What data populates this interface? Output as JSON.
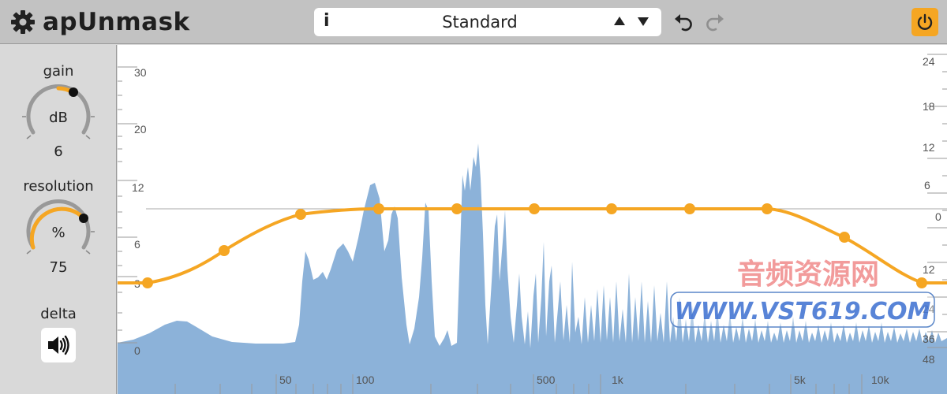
{
  "app": {
    "title": "apUnmask"
  },
  "preset": {
    "info_label": "i",
    "name": "Standard"
  },
  "controls": {
    "gain": {
      "label": "gain",
      "unit": "dB",
      "value": "6"
    },
    "resolution": {
      "label": "resolution",
      "unit": "%",
      "value": "75"
    },
    "delta": {
      "label": "delta"
    }
  },
  "graph": {
    "left_axis_labels": [
      "30",
      "20",
      "12",
      "6",
      "3",
      "0"
    ],
    "right_axis_labels": [
      "24",
      "18",
      "12",
      "6",
      "0",
      "12",
      "24",
      "36",
      "48"
    ],
    "freq_labels": [
      "50",
      "100",
      "500",
      "1k",
      "5k",
      "10k"
    ]
  },
  "watermark": {
    "line1": "音频资源网",
    "line2": "WWW.VST619.COM"
  },
  "colors": {
    "accent": "#f5a623",
    "spectrum": "#8cb2d9",
    "topbar": "#c2c2c2",
    "panel": "#d9d9d9"
  }
}
